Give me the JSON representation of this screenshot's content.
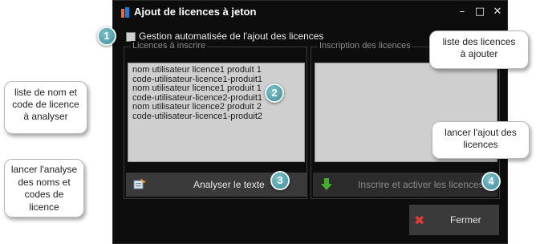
{
  "window": {
    "title": "Ajout de licences à jeton"
  },
  "checkbox": {
    "label": "Gestion automatisée de l'ajout des licences"
  },
  "left_group": {
    "title": "Licences à inscrire",
    "lines": [
      "nom utilisateur licence1 produit 1",
      "code-utilisateur-licence1-produit1",
      "nom utilisateur licence1 produit 1",
      "code-utilisateur-licence2-produit1",
      "nom utilisateur licence2 produit 2",
      "code-utilisateur-licence1-produit2"
    ],
    "button_label": "Analyser le texte"
  },
  "right_group": {
    "title": "Inscription des licences",
    "button_label": "Inscrire et activer les licences"
  },
  "close_button": {
    "label": "Fermer"
  },
  "callouts": {
    "c1": {
      "number": "1"
    },
    "c2": {
      "number": "2",
      "text": [
        "liste de nom et",
        "code de licence",
        "à analyser"
      ]
    },
    "c3": {
      "number": "3",
      "text": [
        "lancer l'analyse",
        "des noms et",
        "codes de",
        "licence"
      ]
    },
    "c4": {
      "number": "4",
      "text": [
        "lancer l'ajout des",
        "licences"
      ]
    },
    "right_top": {
      "text": [
        "liste des licences",
        "à ajouter"
      ]
    }
  },
  "colors": {
    "window_bg": "#0d0d0d",
    "field_bg": "#cfcfcf",
    "badge": "#4f9aa3",
    "close_icon": "#e53935",
    "arrow_icon": "#43b02a"
  }
}
